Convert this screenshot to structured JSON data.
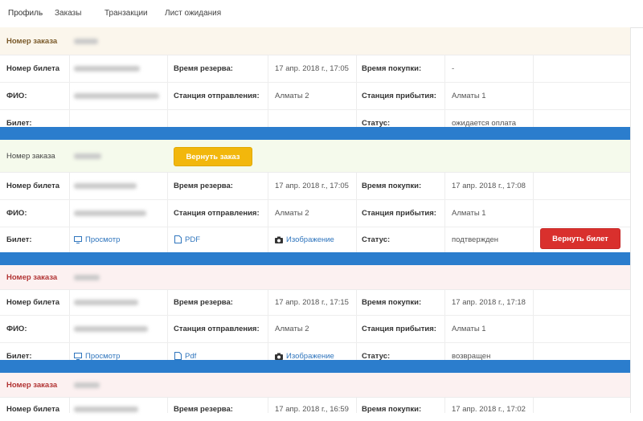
{
  "tabs": [
    "Профиль",
    "Заказы",
    "Транзакции",
    "Лист ожидания"
  ],
  "colors": {
    "accent_blue": "#2b7dcd",
    "order1_bg": "#fbf6ec",
    "order2_bg": "#f5faec",
    "order3_bg": "#fcf1f1",
    "warning_button": "#f2b70c",
    "danger_button": "#d9302d"
  },
  "labels": {
    "order_number": "Номер заказа",
    "ticket_number": "Номер билета",
    "reserve_time": "Время резерва:",
    "purchase_time": "Время покупки:",
    "fio": "ФИО:",
    "departure": "Станция отправления:",
    "arrival": "Станция прибытия:",
    "ticket": "Билет:",
    "status": "Статус:"
  },
  "orders": [
    {
      "reserve_time": "17 апр. 2018 г., 17:05",
      "purchase_time": "-",
      "departure": "Алматы 2",
      "arrival": "Алматы 1",
      "status": "ожидается оплата"
    },
    {
      "reserve_time": "17 апр. 2018 г., 17:05",
      "purchase_time": "17 апр. 2018 г., 17:08",
      "departure": "Алматы 2",
      "arrival": "Алматы 1",
      "status": "подтвержден",
      "view_link": "Просмотр",
      "pdf_link": "PDF",
      "image_link": "Изображение",
      "return_order_button": "Вернуть заказ",
      "return_ticket_button": "Вернуть билет"
    },
    {
      "reserve_time": "17 апр. 2018 г., 17:15",
      "purchase_time": "17 апр. 2018 г., 17:18",
      "departure": "Алматы 2",
      "arrival": "Алматы 1",
      "status": "возвращен",
      "view_link": "Просмотр",
      "pdf_link": "Pdf",
      "image_link": "Изображение"
    },
    {
      "reserve_time": "17 апр. 2018 г., 16:59",
      "purchase_time": "17 апр. 2018 г., 17:02"
    }
  ],
  "icons": {
    "view": "monitor-icon",
    "pdf": "document-icon",
    "image": "camera-icon"
  }
}
